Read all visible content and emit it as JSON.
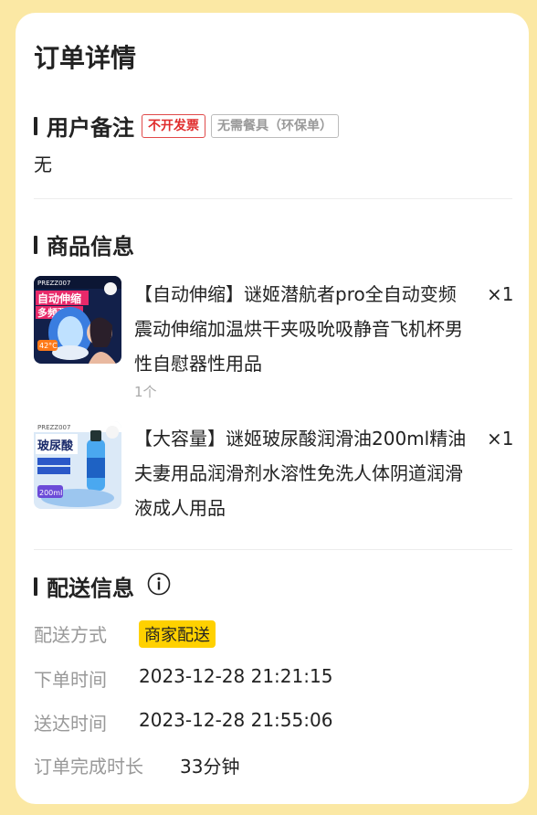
{
  "page": {
    "title": "订单详情"
  },
  "remark": {
    "title": "用户备注",
    "tags": [
      "不开发票",
      "无需餐具（环保单）"
    ],
    "text": "无"
  },
  "products": {
    "title": "商品信息",
    "items": [
      {
        "name": "【自动伸缩】谜姬潜航者pro全自动变频震动伸缩加温烘干夹吸吮吸静音飞机杯男性自慰器性用品",
        "quantity": "×1",
        "unit": "1个",
        "image": {
          "brand": "PREZZ007",
          "headline": "自动伸缩",
          "subline": "多频强",
          "badge": "42°C"
        }
      },
      {
        "name": "【大容量】谜姬玻尿酸润滑油200ml精油夫妻用品润滑剂水溶性免洗人体阴道润滑液成人用品",
        "quantity": "×1",
        "image": {
          "brand": "PREZZ007",
          "headline": "玻尿酸",
          "badge": "200ml"
        }
      }
    ]
  },
  "delivery": {
    "title": "配送信息",
    "icon": "info-icon",
    "method_label": "配送方式",
    "method_value": "商家配送",
    "order_time_label": "下单时间",
    "order_time_value": "2023-12-28 21:21:15",
    "delivered_label": "送达时间",
    "delivered_value": "2023-12-28 21:55:06",
    "duration_label": "订单完成时长",
    "duration_value": "33分钟"
  },
  "colors": {
    "background": "#fbe8a4",
    "accent_yellow": "#ffd100",
    "tag_red": "#e02c2c"
  }
}
